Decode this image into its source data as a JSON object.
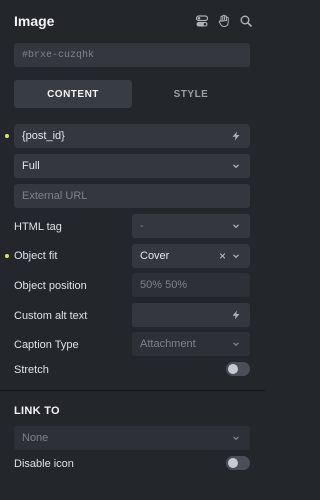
{
  "header": {
    "title": "Image",
    "icons": [
      "toggle-icon",
      "hand-icon",
      "search-icon"
    ]
  },
  "element_id": {
    "placeholder": "#brxe-cuzqhk"
  },
  "tabs": [
    {
      "label": "CONTENT",
      "active": true
    },
    {
      "label": "STYLE",
      "active": false
    }
  ],
  "image_source": {
    "value": "{post_id}"
  },
  "size_select": {
    "value": "Full"
  },
  "external_url": {
    "placeholder": "External URL"
  },
  "html_tag": {
    "label": "HTML tag",
    "value": "-"
  },
  "object_fit": {
    "label": "Object fit",
    "value": "Cover"
  },
  "object_position": {
    "label": "Object position",
    "placeholder": "50% 50%"
  },
  "custom_alt": {
    "label": "Custom alt text"
  },
  "caption_type": {
    "label": "Caption Type",
    "value": "Attachment"
  },
  "stretch": {
    "label": "Stretch",
    "on": false
  },
  "link_to": {
    "title": "LINK TO",
    "select_value": "None",
    "disable_icon_label": "Disable icon",
    "disable_icon_on": false
  },
  "colors": {
    "accent_dot": "#d9e36b",
    "panel_bg": "#23262b",
    "field_bg": "#34373e"
  }
}
